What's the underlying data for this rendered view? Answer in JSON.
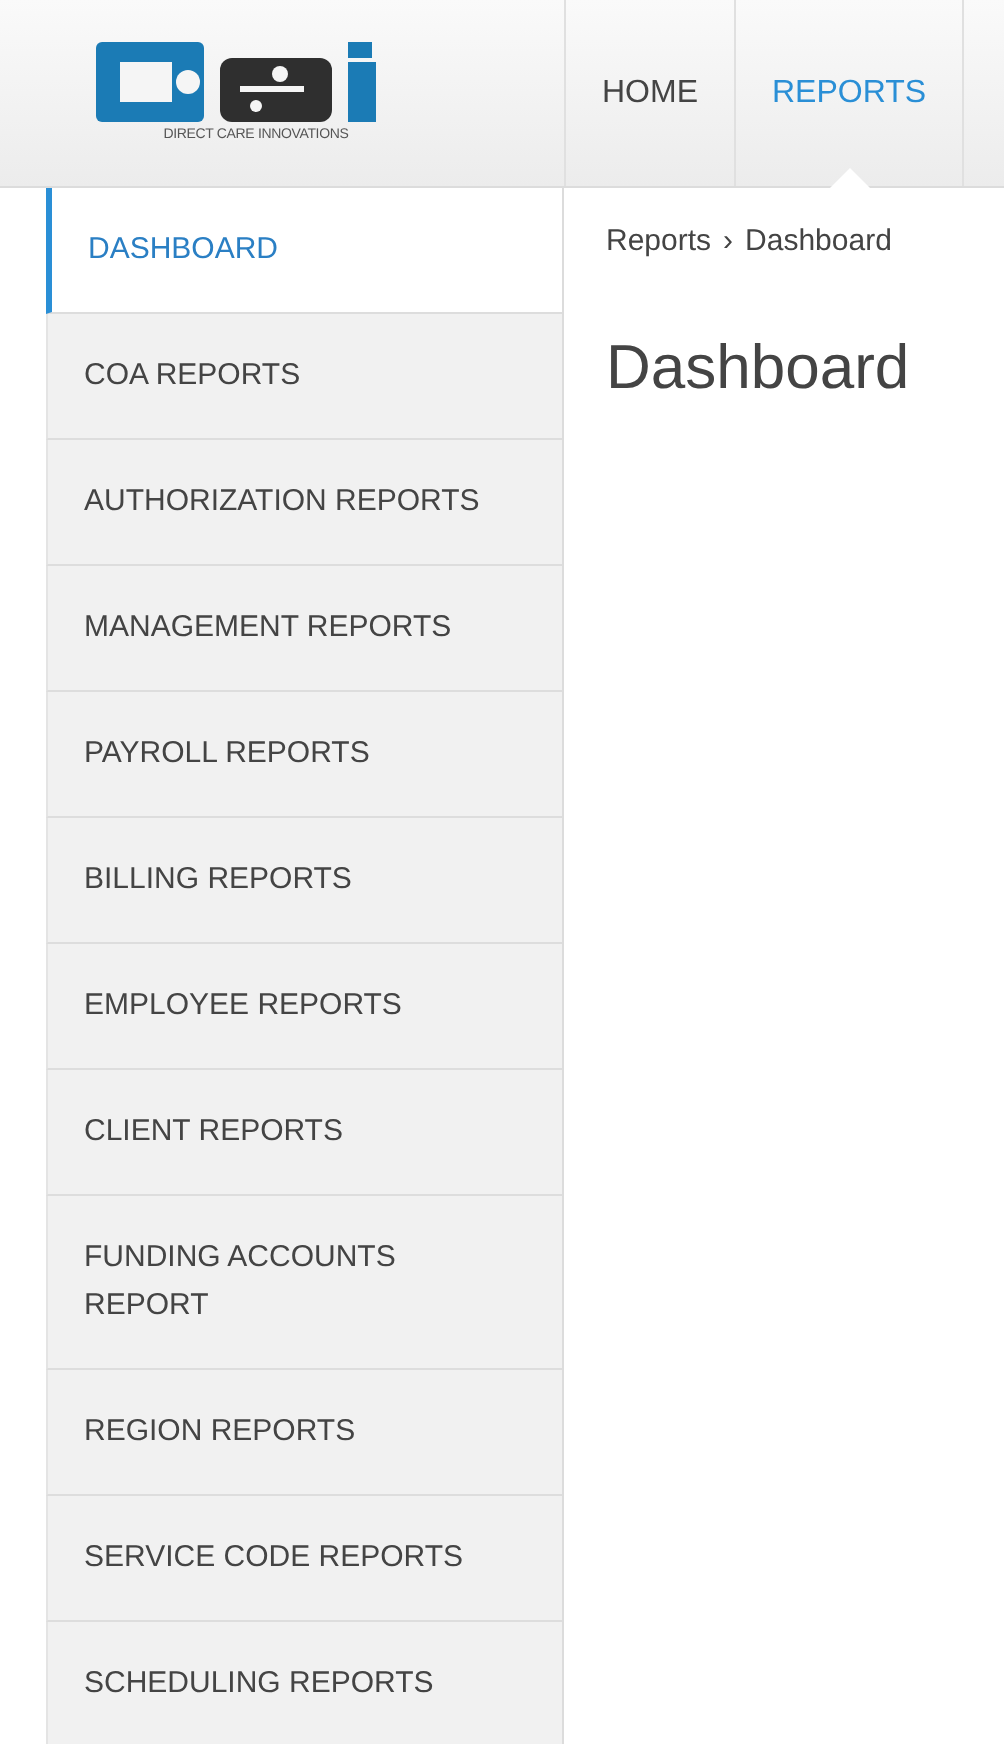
{
  "logo": {
    "tagline": "DIRECT CARE INNOVATIONS"
  },
  "nav": [
    {
      "label": "HOME",
      "selected": false
    },
    {
      "label": "REPORTS",
      "selected": true
    }
  ],
  "sidebar": {
    "items": [
      {
        "label": "DASHBOARD",
        "selected": true
      },
      {
        "label": "COA REPORTS",
        "selected": false
      },
      {
        "label": "AUTHORIZATION REPORTS",
        "selected": false
      },
      {
        "label": "MANAGEMENT REPORTS",
        "selected": false
      },
      {
        "label": "PAYROLL REPORTS",
        "selected": false
      },
      {
        "label": "BILLING REPORTS",
        "selected": false
      },
      {
        "label": "EMPLOYEE REPORTS",
        "selected": false
      },
      {
        "label": "CLIENT REPORTS",
        "selected": false
      },
      {
        "label": "FUNDING ACCOUNTS REPORT",
        "selected": false
      },
      {
        "label": "REGION REPORTS",
        "selected": false
      },
      {
        "label": "SERVICE CODE REPORTS",
        "selected": false
      },
      {
        "label": "SCHEDULING REPORTS",
        "selected": false
      }
    ]
  },
  "breadcrumb": [
    "Reports",
    "Dashboard"
  ],
  "breadcrumb_separator": "›",
  "title": "Dashboard"
}
